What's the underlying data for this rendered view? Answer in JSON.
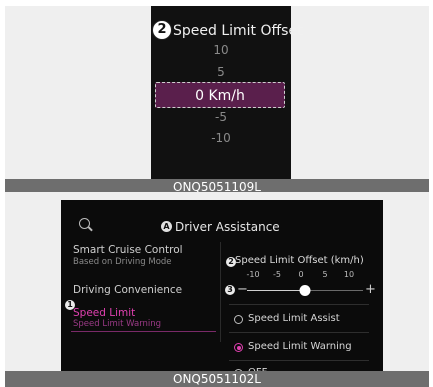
{
  "figure1": {
    "marker": "2",
    "title": "Speed Limit Offset",
    "values_above": [
      "10",
      "5"
    ],
    "selected_value": "0 Km/h",
    "values_below": [
      "-5",
      "-10"
    ],
    "caption": "ONQ5051109L"
  },
  "figure2": {
    "header": {
      "marker": "A",
      "title": "Driver Assistance"
    },
    "menu": {
      "items": [
        {
          "label": "Smart Cruise Control",
          "sub": "Based on Driving Mode"
        },
        {
          "label": "Driving Convenience",
          "sub": ""
        },
        {
          "label": "Speed Limit",
          "sub": "Speed Limit Warning",
          "selected": true
        }
      ],
      "marker": "1"
    },
    "offset": {
      "marker": "2",
      "title": "Speed Limit Offset (km/h)",
      "ticks": [
        "-10",
        "-5",
        "0",
        "5",
        "10"
      ],
      "minus": "−",
      "plus": "+",
      "value": 0,
      "min": -10,
      "max": 10,
      "slider_marker": "3"
    },
    "options": [
      {
        "label": "Speed Limit Assist",
        "checked": false
      },
      {
        "label": "Speed Limit Warning",
        "checked": true
      },
      {
        "label": "OFF",
        "checked": false
      }
    ],
    "caption": "ONQ5051102L"
  },
  "colors": {
    "accent": "#e040b0",
    "panel": "#0b0b0b",
    "selected_bg": "#5a1f4c",
    "caption_bg": "#6e6e6e"
  },
  "icons": {
    "search": "search-icon"
  }
}
